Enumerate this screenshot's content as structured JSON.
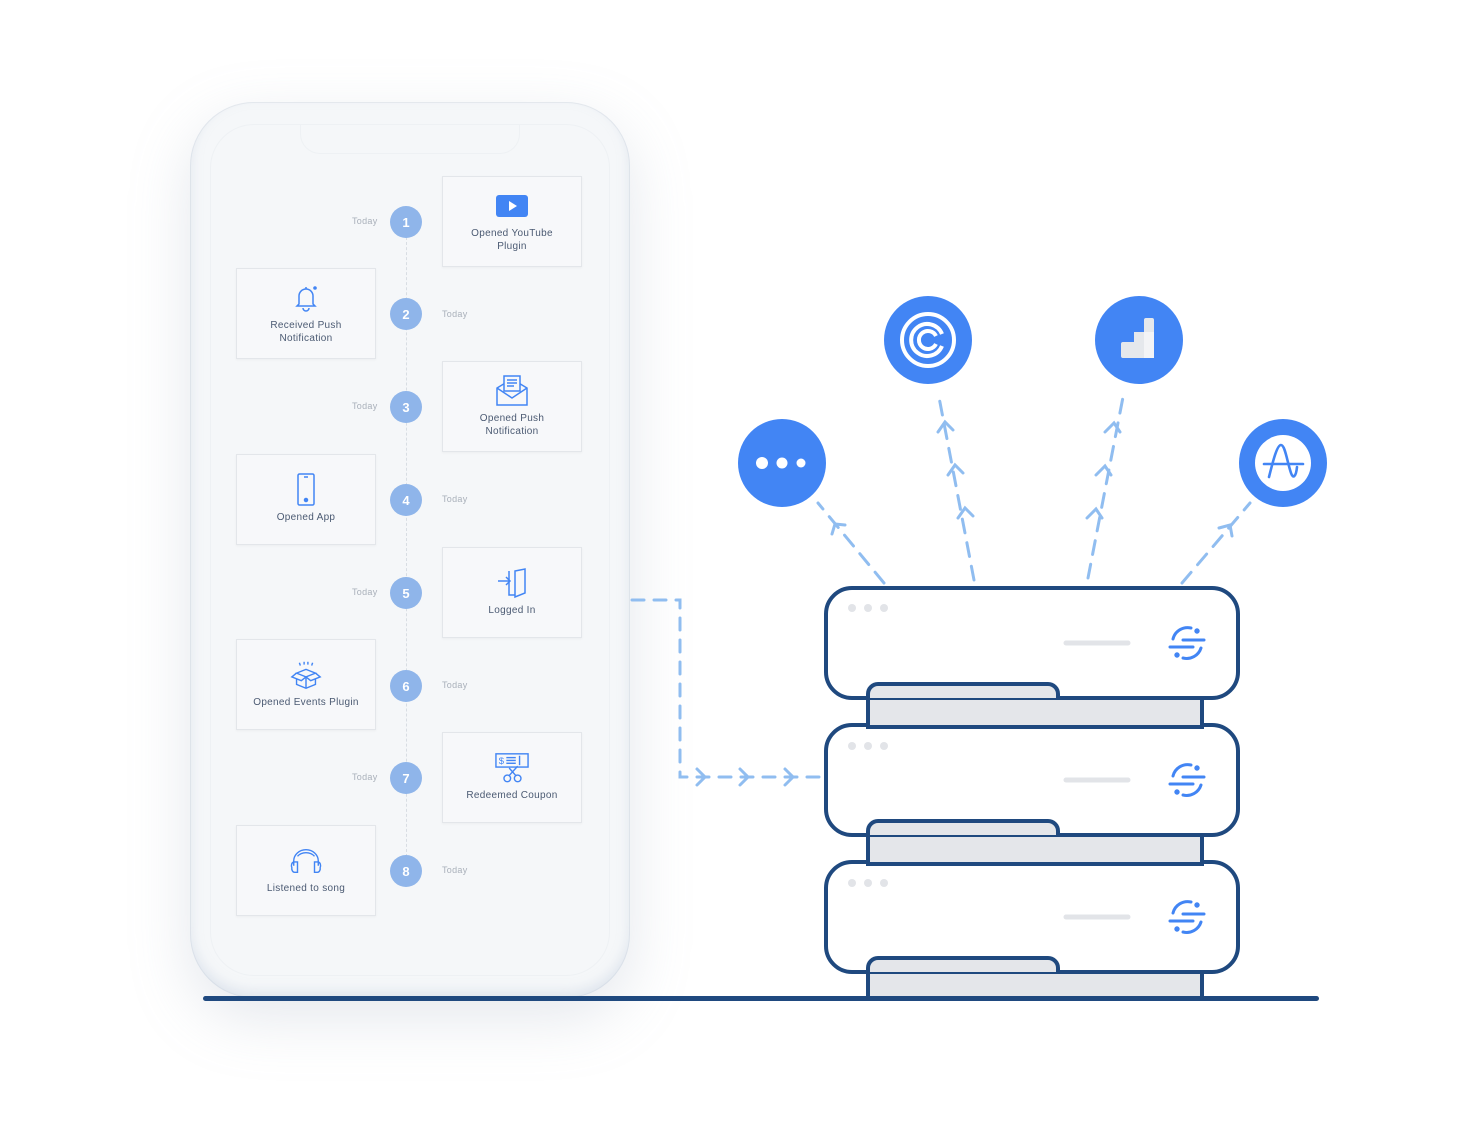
{
  "timeline": {
    "events": [
      {
        "step": "1",
        "label": "Opened YouTube Plugin",
        "time": "Today",
        "side": "right",
        "icon": "youtube-icon"
      },
      {
        "step": "2",
        "label": "Received Push Notification",
        "time": "Today",
        "side": "left",
        "icon": "bell-icon"
      },
      {
        "step": "3",
        "label": "Opened Push Notification",
        "time": "Today",
        "side": "right",
        "icon": "envelope-icon"
      },
      {
        "step": "4",
        "label": "Opened App",
        "time": "Today",
        "side": "left",
        "icon": "phone-icon"
      },
      {
        "step": "5",
        "label": "Logged In",
        "time": "Today",
        "side": "right",
        "icon": "login-door-icon"
      },
      {
        "step": "6",
        "label": "Opened Events Plugin",
        "time": "Today",
        "side": "left",
        "icon": "open-box-icon"
      },
      {
        "step": "7",
        "label": "Redeemed Coupon",
        "time": "Today",
        "side": "right",
        "icon": "coupon-scissors-icon"
      },
      {
        "step": "8",
        "label": "Listened to song",
        "time": "Today",
        "side": "left",
        "icon": "headphones-icon"
      }
    ]
  },
  "integrations": [
    {
      "name": "more-integrations",
      "icon": "ellipsis-icon"
    },
    {
      "name": "swirl-integration",
      "icon": "swirl-logo-icon"
    },
    {
      "name": "analytics-integration",
      "icon": "analytics-bars-icon"
    },
    {
      "name": "amplitude-integration",
      "icon": "amplitude-logo-icon"
    }
  ],
  "servers": [
    {
      "name": "server-1",
      "logo": "segment-logo-icon"
    },
    {
      "name": "server-2",
      "logo": "segment-logo-icon"
    },
    {
      "name": "server-3",
      "logo": "segment-logo-icon"
    }
  ],
  "colors": {
    "accent": "#4285f4",
    "step_circle": "#8fb5ea",
    "dashed_arrow": "#90bdf0",
    "server_outline": "#1f497f",
    "server_base": "#e4e6ea"
  }
}
